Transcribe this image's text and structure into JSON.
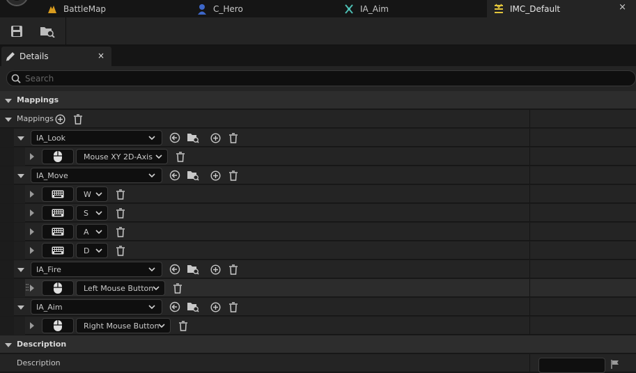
{
  "tabs": [
    {
      "label": "BattleMap",
      "icon": "level-icon"
    },
    {
      "label": "C_Hero",
      "icon": "character-icon"
    },
    {
      "label": "IA_Aim",
      "icon": "input-action-icon"
    },
    {
      "label": "IMC_Default",
      "icon": "input-mapping-context-icon",
      "close": "×"
    }
  ],
  "panel": {
    "title": "Details",
    "close": "×"
  },
  "search": {
    "placeholder": "Search",
    "value": ""
  },
  "categories": {
    "mappings": "Mappings",
    "description": "Description"
  },
  "mappings_row": {
    "label": "Mappings"
  },
  "actions": [
    {
      "name": "IA_Look",
      "keys": [
        {
          "device": "mouse",
          "key": "Mouse XY 2D-Axis"
        }
      ]
    },
    {
      "name": "IA_Move",
      "keys": [
        {
          "device": "keyboard",
          "key": "W"
        },
        {
          "device": "keyboard",
          "key": "S"
        },
        {
          "device": "keyboard",
          "key": "A"
        },
        {
          "device": "keyboard",
          "key": "D"
        }
      ]
    },
    {
      "name": "IA_Fire",
      "keys": [
        {
          "device": "mouse",
          "key": "Left Mouse Button"
        }
      ]
    },
    {
      "name": "IA_Aim",
      "keys": [
        {
          "device": "mouse",
          "key": "Right Mouse Button"
        }
      ]
    }
  ],
  "description_row": {
    "label": "Description"
  }
}
